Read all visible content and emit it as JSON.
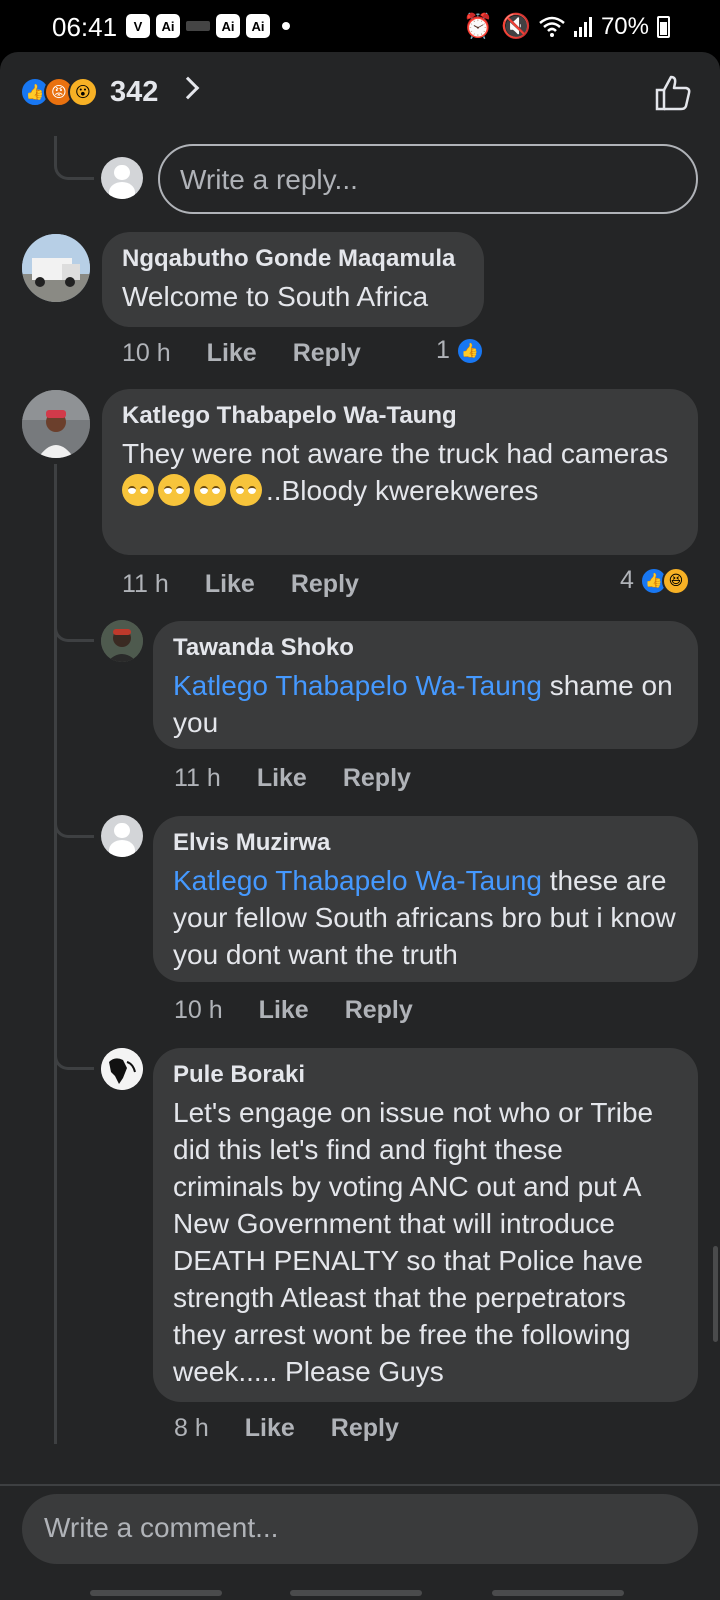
{
  "status_bar": {
    "time": "06:41",
    "left_icons": [
      "vpn-icon",
      "ai-icon",
      "ai-icon",
      "ai-icon"
    ],
    "battery": "70%"
  },
  "header": {
    "reaction_count": "342",
    "reactions": [
      "like",
      "angry",
      "wow"
    ]
  },
  "reply_box": {
    "placeholder": "Write a reply..."
  },
  "comments": [
    {
      "author": "Ngqabutho Gonde Maqamula",
      "text": "Welcome to South Africa",
      "time": "10 h",
      "like": "Like",
      "reply": "Reply",
      "reaction_count": "1"
    },
    {
      "author": "Katlego Thabapelo Wa-Taung",
      "text_before": "They were not aware the truck had cameras",
      "text_after": "..Bloody kwerekweres",
      "time": "11 h",
      "like": "Like",
      "reply": "Reply",
      "reaction_count": "4"
    },
    {
      "author": "Tawanda Shoko",
      "mention": "Katlego Thabapelo Wa-Taung",
      "text": " shame on you",
      "time": "11 h",
      "like": "Like",
      "reply": "Reply"
    },
    {
      "author": "Elvis Muzirwa",
      "mention": "Katlego Thabapelo Wa-Taung",
      "text": " these are your fellow South africans bro but i know you dont want the truth",
      "time": "10 h",
      "like": "Like",
      "reply": "Reply"
    },
    {
      "author": "Pule Boraki",
      "text": "Let's engage on issue not who or Tribe did this let's find and fight these criminals by voting ANC out and put A New Government that will introduce DEATH PENALTY so that Police have strength Atleast that the perpetrators they arrest wont be free the following week..... Please Guys",
      "time": "8 h",
      "like": "Like",
      "reply": "Reply"
    }
  ],
  "comment_box": {
    "placeholder": "Write a comment..."
  },
  "colors": {
    "background": "#242526",
    "bubble": "#3a3b3c",
    "mention": "#4599ff",
    "like_blue": "#1877f2"
  }
}
